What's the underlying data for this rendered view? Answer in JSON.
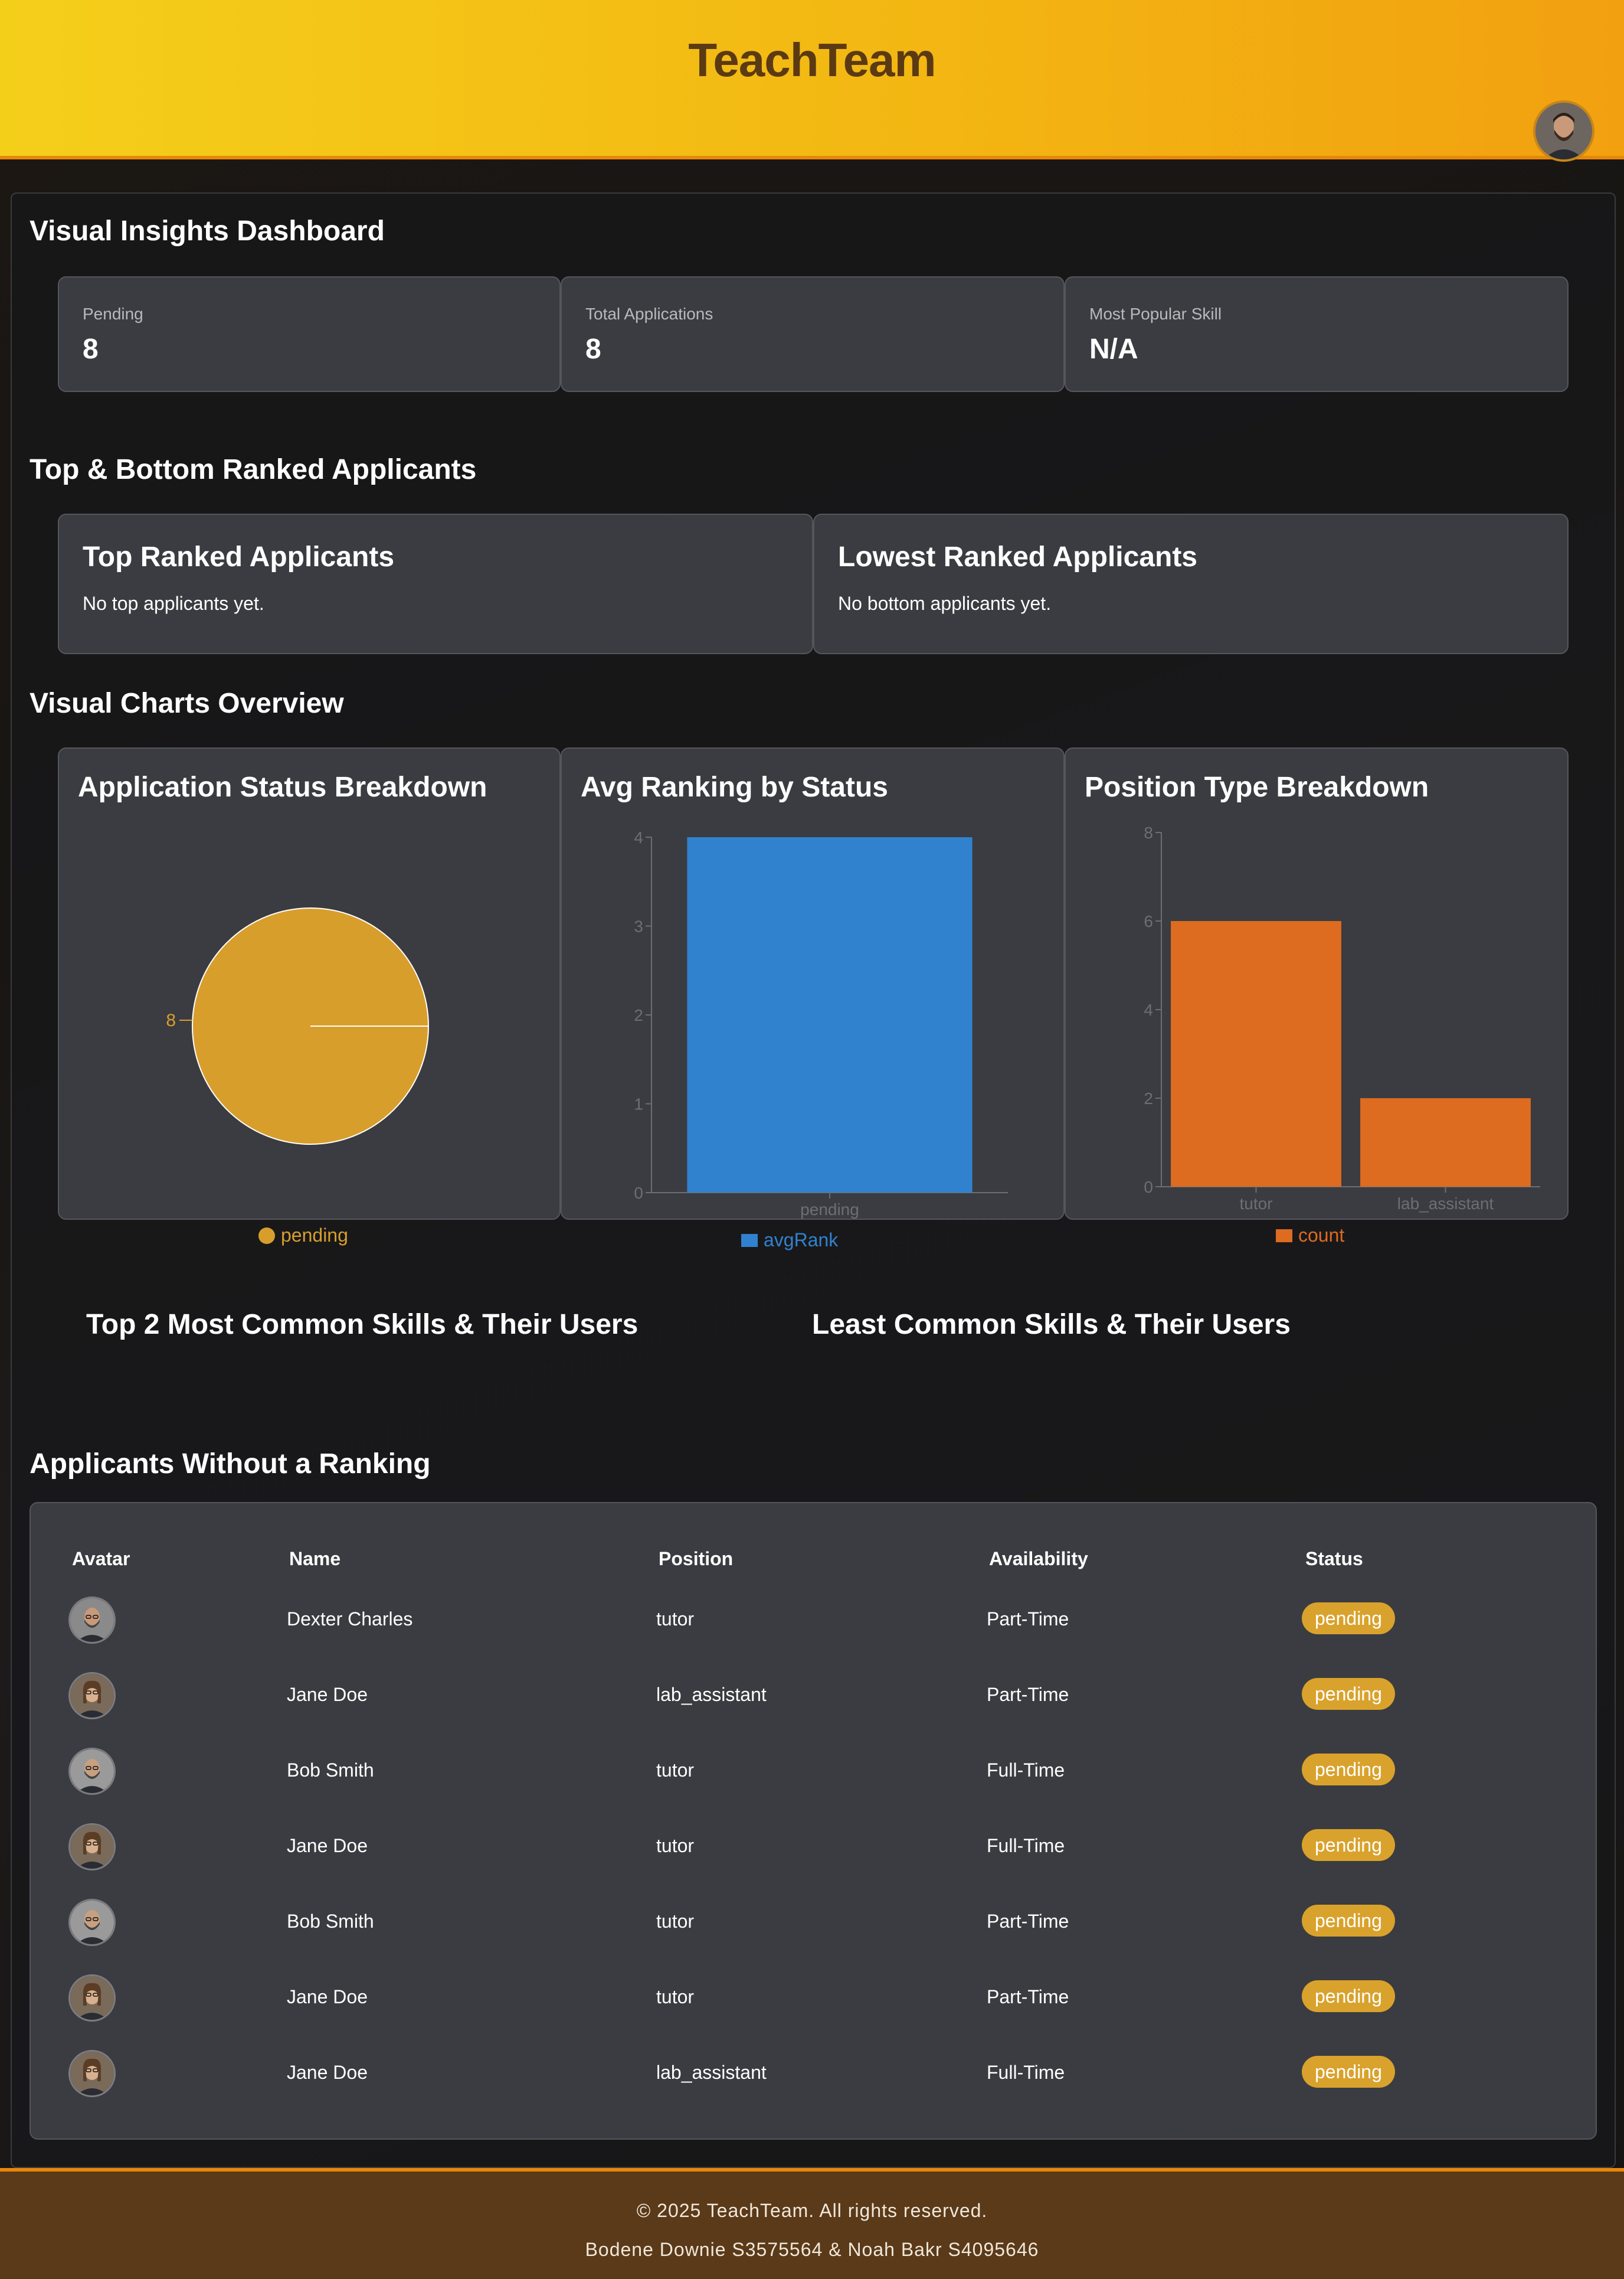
{
  "header": {
    "brand": "TeachTeam",
    "avatar_icon": "user-avatar-icon"
  },
  "dashboard": {
    "title": "Visual Insights Dashboard",
    "stats": [
      {
        "label": "Pending",
        "value": "8"
      },
      {
        "label": "Total Applications",
        "value": "8"
      },
      {
        "label": "Most Popular Skill",
        "value": "N/A"
      }
    ]
  },
  "ranked": {
    "section_title": "Top & Bottom Ranked Applicants",
    "top": {
      "title": "Top Ranked Applicants",
      "empty": "No top applicants yet."
    },
    "bottom": {
      "title": "Lowest Ranked Applicants",
      "empty": "No bottom applicants yet."
    }
  },
  "charts": {
    "section_title": "Visual Charts Overview"
  },
  "chart_data": [
    {
      "type": "pie",
      "title": "Application Status Breakdown",
      "categories": [
        "pending"
      ],
      "values": [
        8
      ],
      "data_labels": [
        "8"
      ],
      "legend": [
        "pending"
      ],
      "legend_position": "bottom",
      "colors": [
        "#d89e2c"
      ]
    },
    {
      "type": "bar",
      "title": "Avg Ranking by Status",
      "categories": [
        "pending"
      ],
      "series": [
        {
          "name": "avgRank",
          "values": [
            4
          ]
        }
      ],
      "ylim": [
        0,
        4
      ],
      "yticks": [
        "0",
        "1",
        "2",
        "3",
        "4"
      ],
      "legend_position": "bottom",
      "colors": [
        "#3182ce"
      ]
    },
    {
      "type": "bar",
      "title": "Position Type Breakdown",
      "categories": [
        "tutor",
        "lab_assistant"
      ],
      "series": [
        {
          "name": "count",
          "values": [
            6,
            2
          ]
        }
      ],
      "ylim": [
        0,
        8
      ],
      "yticks": [
        "0",
        "2",
        "4",
        "6",
        "8"
      ],
      "legend_position": "bottom",
      "colors": [
        "#dd6b20"
      ]
    }
  ],
  "skills": {
    "top_title": "Top 2 Most Common Skills & Their Users",
    "least_title": "Least Common Skills & Their Users"
  },
  "unranked": {
    "section_title": "Applicants Without a Ranking",
    "columns": [
      "Avatar",
      "Name",
      "Position",
      "Availability",
      "Status"
    ],
    "rows": [
      {
        "name": "Dexter Charles",
        "position": "tutor",
        "availability": "Part-Time",
        "status": "pending"
      },
      {
        "name": "Jane Doe",
        "position": "lab_assistant",
        "availability": "Part-Time",
        "status": "pending"
      },
      {
        "name": "Bob Smith",
        "position": "tutor",
        "availability": "Full-Time",
        "status": "pending"
      },
      {
        "name": "Jane Doe",
        "position": "tutor",
        "availability": "Full-Time",
        "status": "pending"
      },
      {
        "name": "Bob Smith",
        "position": "tutor",
        "availability": "Part-Time",
        "status": "pending"
      },
      {
        "name": "Jane Doe",
        "position": "tutor",
        "availability": "Part-Time",
        "status": "pending"
      },
      {
        "name": "Jane Doe",
        "position": "lab_assistant",
        "availability": "Full-Time",
        "status": "pending"
      }
    ]
  },
  "footer": {
    "copyright": "© 2025 TeachTeam. All rights reserved.",
    "authors": "Bodene Downie S3575564 & Noah Bakr S4095646"
  },
  "colors": {
    "header_start": "#f4cf1a",
    "header_end": "#f2a010",
    "brand_text": "#5b3a13",
    "badge": "#d9a22c",
    "footer_bg": "#5a3a19"
  }
}
